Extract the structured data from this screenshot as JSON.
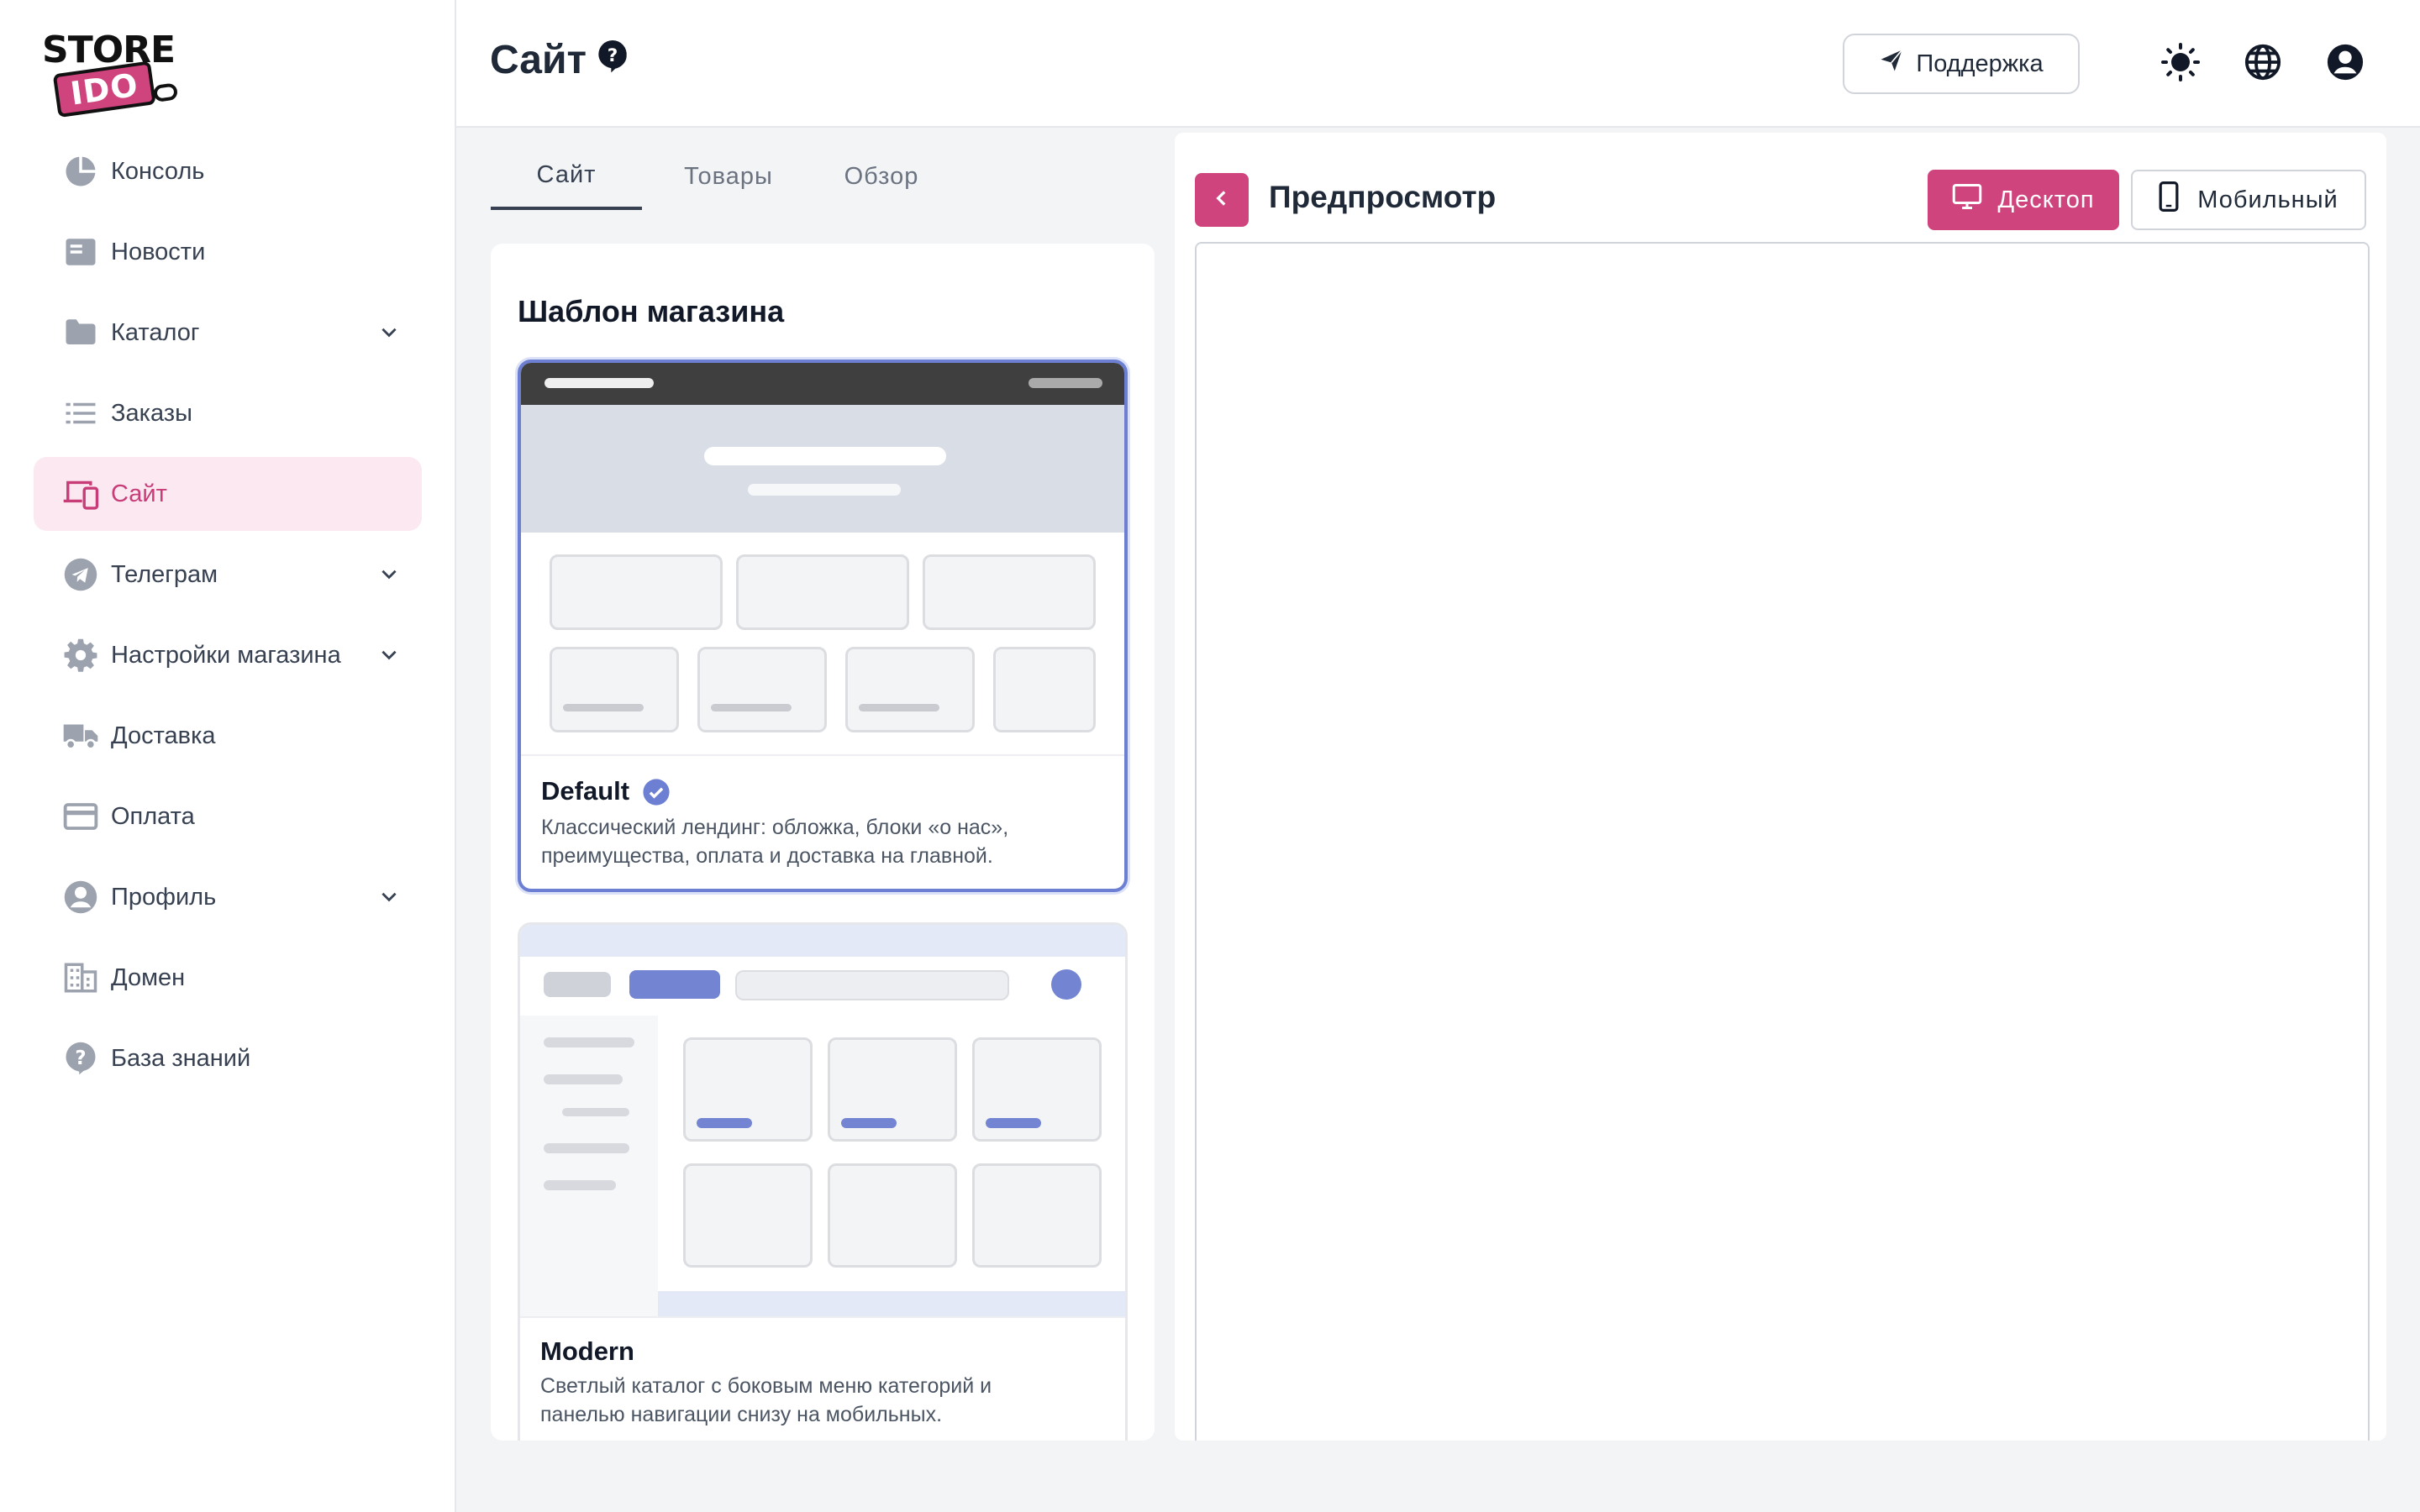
{
  "brand": {
    "top": "STORE",
    "bottom": "IDO",
    "accent_color": "#d0447e"
  },
  "sidebar": {
    "items": [
      {
        "label": "Консоль",
        "icon": "pie-chart-icon",
        "has_submenu": false,
        "active": false
      },
      {
        "label": "Новости",
        "icon": "newspaper-icon",
        "has_submenu": false,
        "active": false
      },
      {
        "label": "Каталог",
        "icon": "folder-icon",
        "has_submenu": true,
        "active": false
      },
      {
        "label": "Заказы",
        "icon": "list-icon",
        "has_submenu": false,
        "active": false
      },
      {
        "label": "Сайт",
        "icon": "devices-icon",
        "has_submenu": false,
        "active": true
      },
      {
        "label": "Телеграм",
        "icon": "telegram-icon",
        "has_submenu": true,
        "active": false
      },
      {
        "label": "Настройки магазина",
        "icon": "gear-icon",
        "has_submenu": true,
        "active": false
      },
      {
        "label": "Доставка",
        "icon": "truck-icon",
        "has_submenu": false,
        "active": false
      },
      {
        "label": "Оплата",
        "icon": "credit-card-icon",
        "has_submenu": false,
        "active": false
      },
      {
        "label": "Профиль",
        "icon": "user-circle-icon",
        "has_submenu": true,
        "active": false
      },
      {
        "label": "Домен",
        "icon": "building-icon",
        "has_submenu": false,
        "active": false
      },
      {
        "label": "База знаний",
        "icon": "help-circle-icon",
        "has_submenu": false,
        "active": false
      }
    ]
  },
  "header": {
    "title": "Сайт",
    "support_label": "Поддержка",
    "icons": [
      "theme-sun-icon",
      "language-globe-icon",
      "account-icon"
    ]
  },
  "tabs": [
    {
      "label": "Сайт",
      "active": true
    },
    {
      "label": "Товары",
      "active": false
    },
    {
      "label": "Обзор",
      "active": false
    }
  ],
  "templates": {
    "title": "Шаблон магазина",
    "items": [
      {
        "name": "Default",
        "selected": true,
        "description": "Классический лендинг: обложка, блоки «о нас», преимущества, оплата и доставка на главной."
      },
      {
        "name": "Modern",
        "selected": false,
        "description": "Светлый каталог с боковым меню категорий и панелью навигации снизу на мобильных."
      }
    ]
  },
  "preview": {
    "title": "Предпросмотр",
    "desktop_label": "Десктоп",
    "mobile_label": "Мобильный",
    "mode": "desktop"
  }
}
